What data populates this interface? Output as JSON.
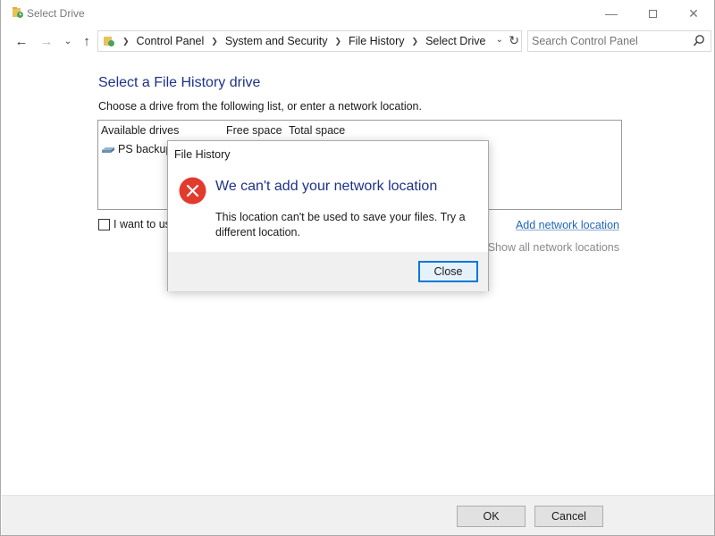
{
  "window": {
    "title": "Select Drive",
    "icon": "file-history-folder-icon"
  },
  "nav": {
    "breadcrumbs": [
      "Control Panel",
      "System and Security",
      "File History",
      "Select Drive"
    ],
    "search_placeholder": "Search Control Panel"
  },
  "main": {
    "heading": "Select a File History drive",
    "instruction": "Choose a drive from the following list, or enter a network location.",
    "columns": [
      "Available drives",
      "Free space",
      "Total space"
    ],
    "drives": [
      {
        "name": "PS backup-"
      }
    ],
    "checkbox_label": "I want to us",
    "add_network_link": "Add network location",
    "show_all_link": "Show all network locations"
  },
  "buttons": {
    "ok": "OK",
    "cancel": "Cancel"
  },
  "dialog": {
    "title": "File History",
    "icon": "error-icon",
    "main_instruction": "We can't add your network location",
    "body": "This location can't be used to save your files. Try a different location.",
    "close_label": "Close"
  },
  "colors": {
    "heading_blue": "#1e3287",
    "link_blue": "#1e66bb",
    "error_red": "#e81123",
    "focus_blue": "#0078d7"
  }
}
